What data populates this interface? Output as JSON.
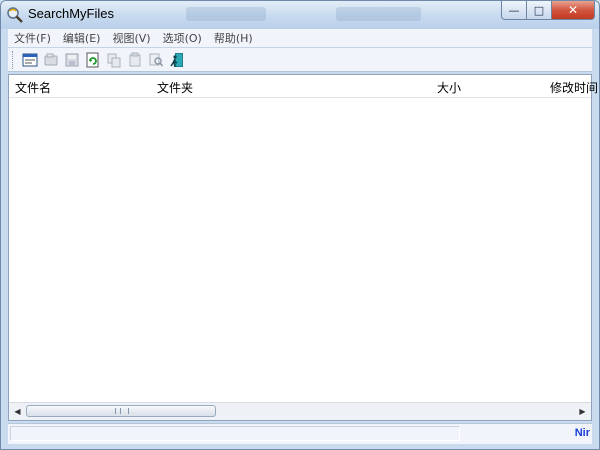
{
  "window": {
    "title": "SearchMyFiles",
    "minimize_glyph": "—",
    "maximize_glyph": "□",
    "close_glyph": "✕"
  },
  "menu": {
    "items": [
      "文件(F)",
      "编辑(E)",
      "视图(V)",
      "选项(O)",
      "帮助(H)"
    ]
  },
  "toolbar": {
    "buttons": [
      {
        "icon": "search-options-icon",
        "enabled": true
      },
      {
        "icon": "stop-icon",
        "enabled": false
      },
      {
        "icon": "save-icon",
        "enabled": false
      },
      {
        "icon": "refresh-icon",
        "enabled": true
      },
      {
        "icon": "copy-icon",
        "enabled": false
      },
      {
        "icon": "properties-icon",
        "enabled": false
      },
      {
        "icon": "find-icon",
        "enabled": false
      },
      {
        "icon": "exit-icon",
        "enabled": true
      }
    ]
  },
  "list": {
    "columns": [
      "文件名",
      "文件夹",
      "大小",
      "修改时间"
    ],
    "rows": []
  },
  "scrollbar": {
    "grip_text": ""
  },
  "status": {
    "left_text": "",
    "brand": "Nir"
  },
  "colors": {
    "close_button": "#c23a22",
    "status_brand": "#1a3cd6"
  }
}
